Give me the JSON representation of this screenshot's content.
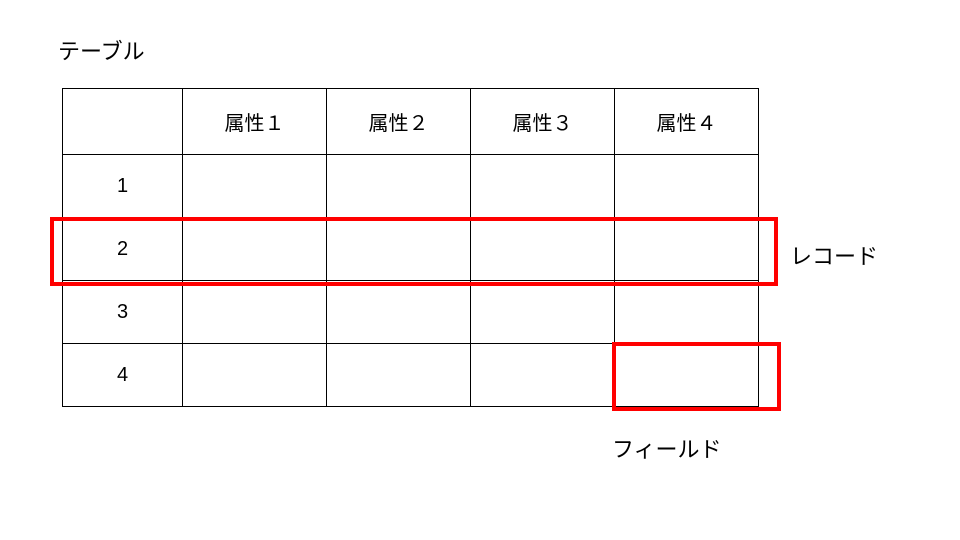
{
  "title": "テーブル",
  "headers": {
    "blank": "",
    "attr1": "属性１",
    "attr2": "属性２",
    "attr3": "属性３",
    "attr4": "属性４"
  },
  "rows": {
    "r1": "1",
    "r2": "2",
    "r3": "3",
    "r4": "4"
  },
  "labels": {
    "record": "レコード",
    "field": "フィールド"
  }
}
